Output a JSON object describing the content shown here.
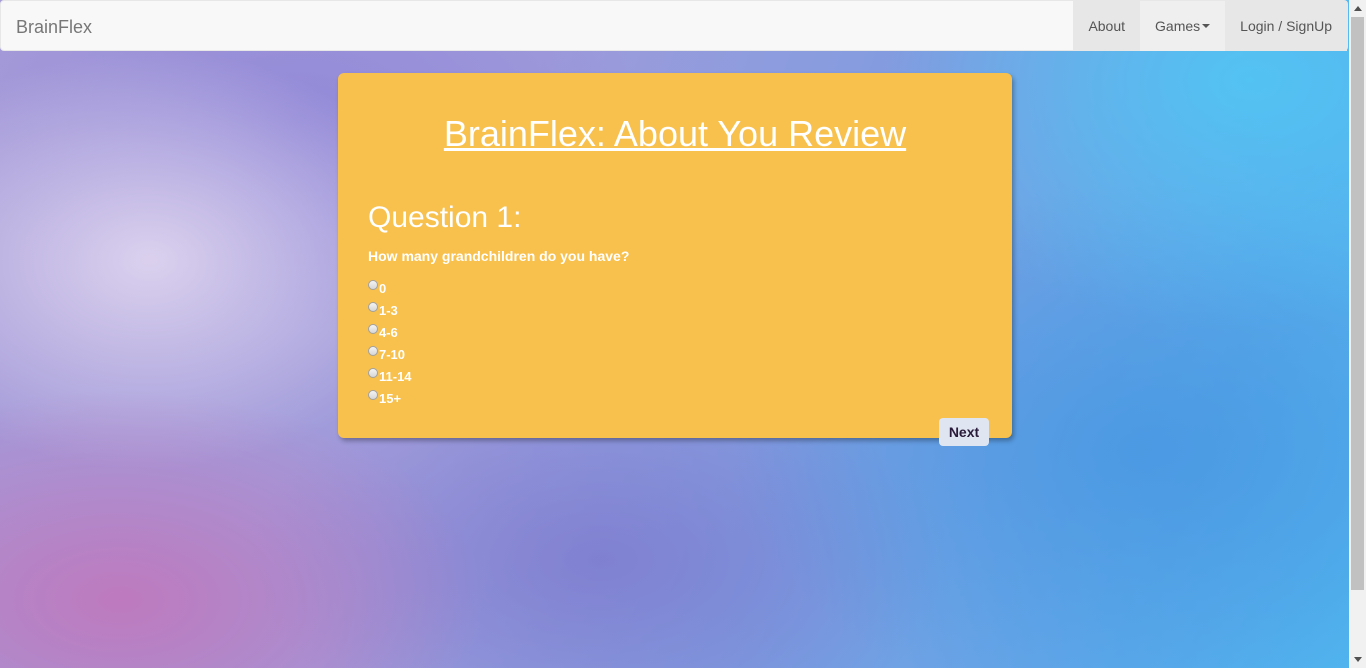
{
  "navbar": {
    "brand": "BrainFlex",
    "items": [
      {
        "label": "About"
      },
      {
        "label": "Games"
      },
      {
        "label": "Login / SignUp"
      }
    ]
  },
  "quiz": {
    "title": "BrainFlex: About You Review",
    "question_heading": "Question 1:",
    "question_text": "How many grandchildren do you have?",
    "options": [
      {
        "label": "0"
      },
      {
        "label": "1-3"
      },
      {
        "label": "4-6"
      },
      {
        "label": "7-10"
      },
      {
        "label": "11-14"
      },
      {
        "label": "15+"
      }
    ],
    "next_label": "Next"
  },
  "colors": {
    "card": "#f8c04d",
    "navbar": "#f8f8f8",
    "next_button": "#dfe6f2"
  }
}
